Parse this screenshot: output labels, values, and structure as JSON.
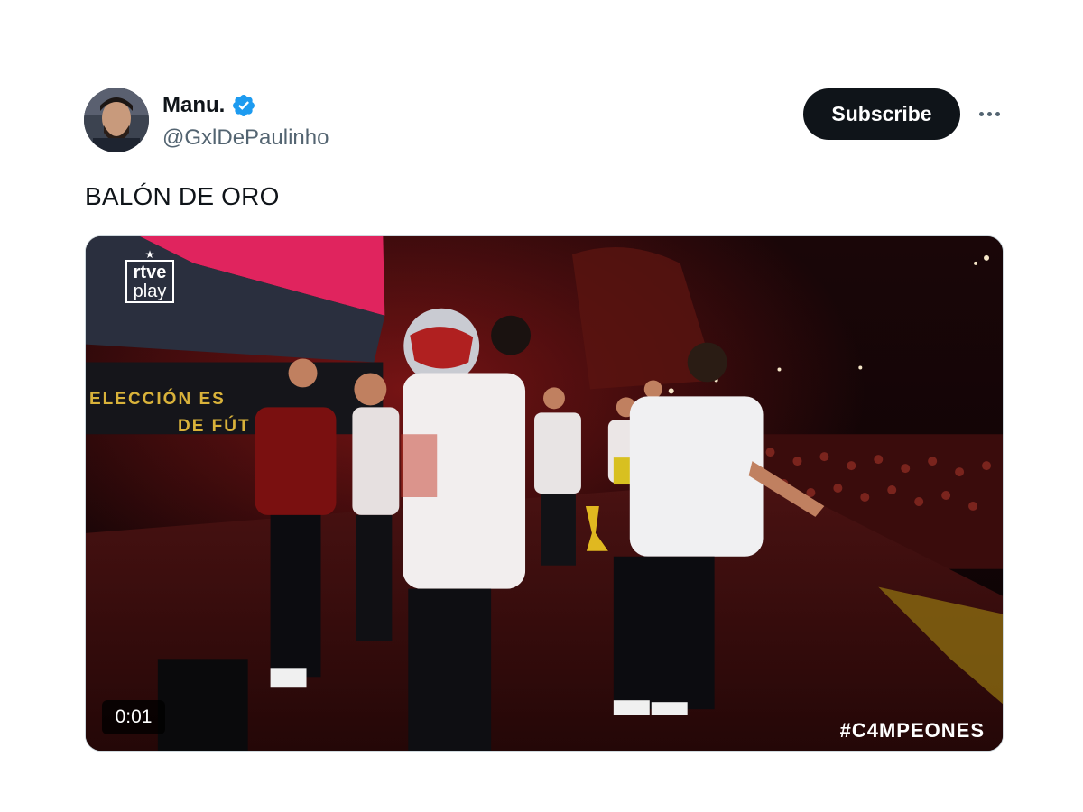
{
  "author": {
    "display_name": "Manu.",
    "handle": "@GxlDePaulinho",
    "verified": true
  },
  "actions": {
    "subscribe_label": "Subscribe",
    "more_icon": "more-horizontal-icon"
  },
  "tweet": {
    "text": "BALÓN DE ORO"
  },
  "video": {
    "duration": "0:01",
    "overlay_hashtag": "#C4MPEONES",
    "channel_logo_line1": "rtve",
    "channel_logo_line2": "play",
    "banner_line1": "ELECCIÓN ES",
    "banner_line2": "DE FÚT"
  },
  "colors": {
    "verified": "#1d9bf0",
    "button": "#0f1419",
    "text": "#0f1419",
    "secondary_text": "#536471"
  }
}
